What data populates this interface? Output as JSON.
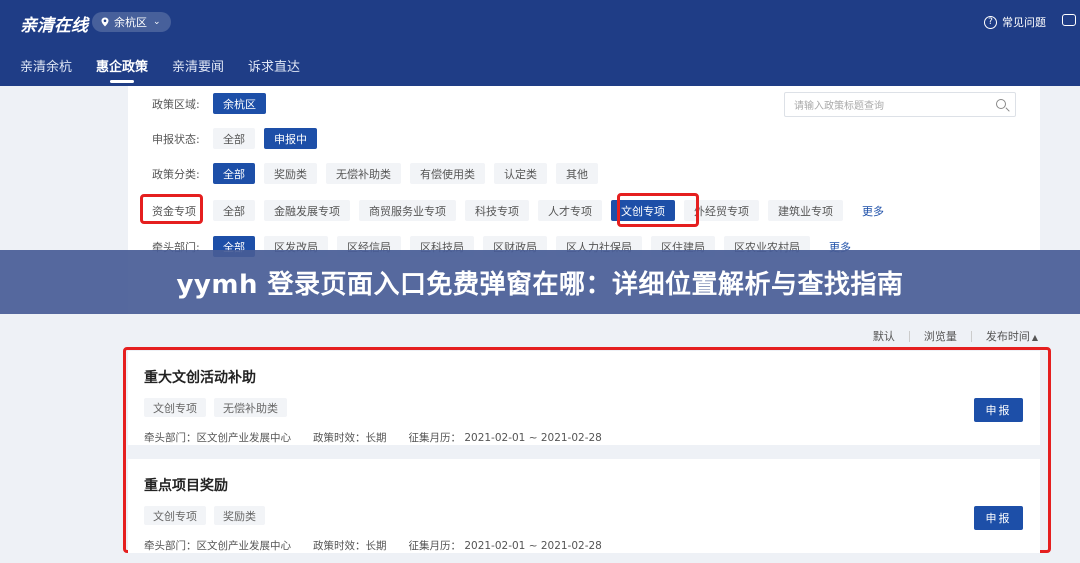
{
  "header": {
    "brand": "亲清在线",
    "region": "余杭区",
    "faq_label": "常见问题",
    "faq_mark": "?",
    "region_chevron": "⌄"
  },
  "nav": {
    "tabs": [
      {
        "label": "亲清余杭",
        "active": false
      },
      {
        "label": "惠企政策",
        "active": true
      },
      {
        "label": "亲清要闻",
        "active": false
      },
      {
        "label": "诉求直达",
        "active": false
      }
    ]
  },
  "filters": {
    "search_placeholder": "请输入政策标题查询",
    "rows": [
      {
        "label": "政策区域:",
        "options": [
          "余杭区"
        ],
        "active": "余杭区"
      },
      {
        "label": "申报状态:",
        "options": [
          "全部",
          "申报中"
        ],
        "active": "申报中"
      },
      {
        "label": "政策分类:",
        "options": [
          "全部",
          "奖励类",
          "无偿补助类",
          "有偿使用类",
          "认定类",
          "其他"
        ],
        "active": "全部"
      },
      {
        "label": "资金专项",
        "options": [
          "全部",
          "金融发展专项",
          "商贸服务业专项",
          "科技专项",
          "人才专项",
          "文创专项",
          "外经贸专项",
          "建筑业专项"
        ],
        "active": "文创专项",
        "more": "更多"
      },
      {
        "label": "牵头部门:",
        "options": [
          "全部",
          "区发改局",
          "区经信局",
          "区科技局",
          "区财政局",
          "区人力社保局",
          "区住建局",
          "区农业农村局"
        ],
        "active": "全部",
        "more": "更多"
      }
    ]
  },
  "banner": {
    "text": "yymh 登录页面入口免费弹窗在哪：详细位置解析与查找指南"
  },
  "sort": {
    "default": "默认",
    "views": "浏览量",
    "publish_time": "发布时间",
    "arrow": "▲"
  },
  "cards": [
    {
      "title": "重大文创活动补助",
      "tags": [
        "文创专项",
        "无偿补助类"
      ],
      "dept": "牵头部门：区文创产业发展中心",
      "validity": "政策时效：长期",
      "period": "征集月历：  2021-02-01 ~ 2021-02-28",
      "button": "申报"
    },
    {
      "title": "重点项目奖励",
      "tags": [
        "文创专项",
        "奖励类"
      ],
      "dept": "牵头部门：区文创产业发展中心",
      "validity": "政策时效：长期",
      "period": "征集月历：  2021-02-01 ~ 2021-02-28",
      "button": "申报"
    }
  ],
  "colors": {
    "header_bg": "#1f3d86",
    "accent": "#1d4fa8",
    "highlight_box": "#e51f1f",
    "banner_bg": "#485c96"
  }
}
